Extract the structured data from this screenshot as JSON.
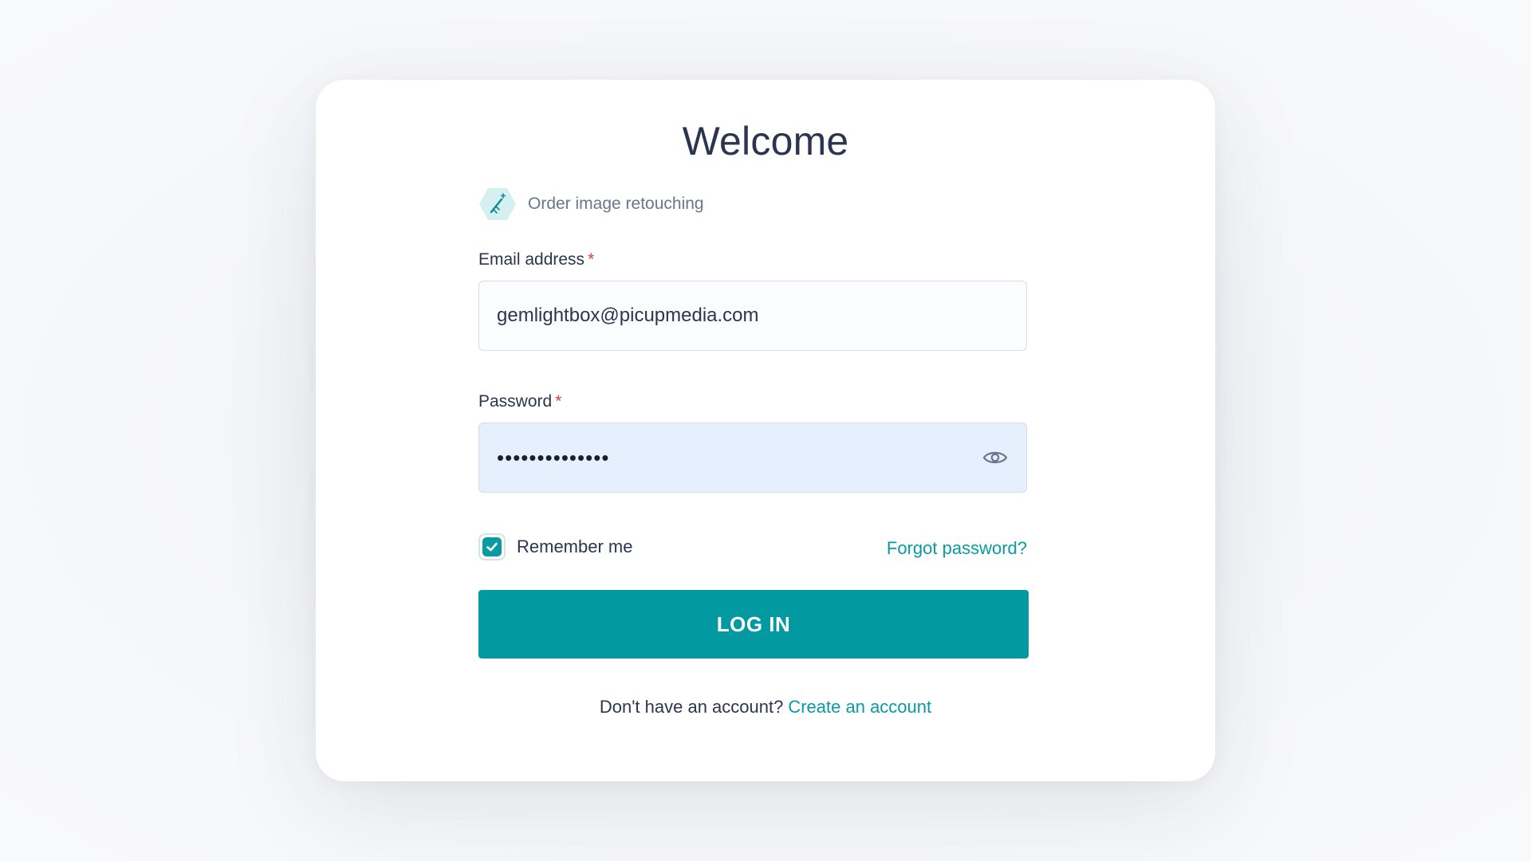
{
  "card": {
    "title": "Welcome",
    "service": {
      "icon": "magic-wand-icon",
      "label": "Order image retouching"
    }
  },
  "form": {
    "email": {
      "label": "Email address",
      "required_marker": "*",
      "value": "gemlightbox@picupmedia.com"
    },
    "password": {
      "label": "Password",
      "required_marker": "*",
      "masked_value": "••••••••••••••",
      "toggle_icon": "eye-icon"
    },
    "remember_me": {
      "label": "Remember me",
      "checked": true
    },
    "forgot_password_label": "Forgot password?",
    "submit_label": "LOG IN"
  },
  "signup": {
    "prompt": "Don't have an account?",
    "link_label": "Create an account"
  },
  "colors": {
    "accent": "#0399a1",
    "link": "#0a9aa2",
    "required": "#e03a3a",
    "text": "#2c3550",
    "password_bg": "#e6effd"
  }
}
